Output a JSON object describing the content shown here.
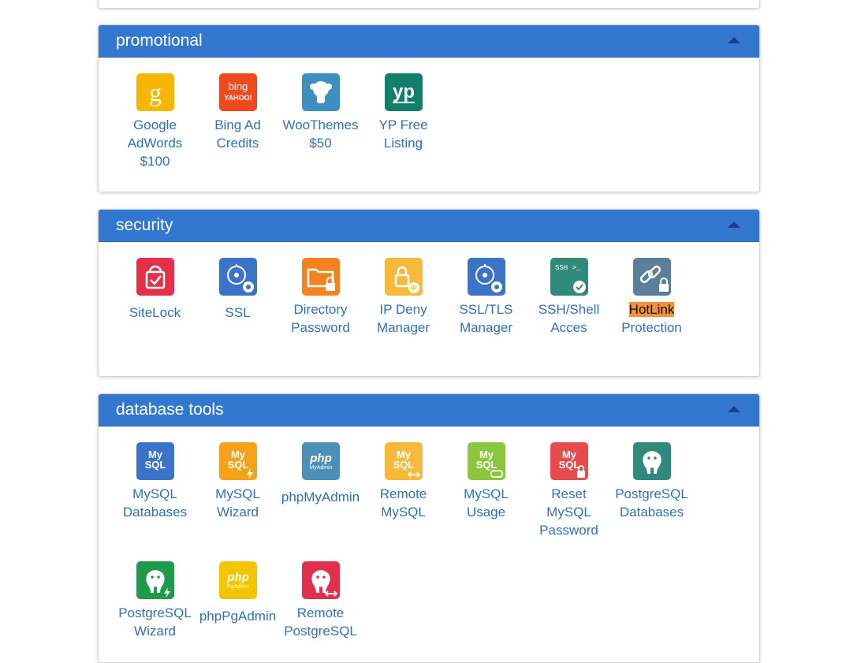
{
  "sections": [
    {
      "title": "promotional",
      "items": [
        {
          "label": "Google AdWords $100",
          "lines": [
            "Google",
            "AdWords",
            "$100"
          ],
          "icon": "google-adwords-icon",
          "color": "#f9b600"
        },
        {
          "label": "Bing Ad Credits",
          "lines": [
            "Bing Ad",
            "Credits"
          ],
          "icon": "bing-yahoo-icon",
          "color": "#ef4a1e",
          "glyph": [
            "bing",
            "YAHOO!"
          ]
        },
        {
          "label": "WooThemes $50",
          "lines": [
            "WooThemes",
            "$50"
          ],
          "icon": "woothemes-icon",
          "color": "#3d8fbf"
        },
        {
          "label": "YP Free Listing",
          "lines": [
            "YP Free",
            "Listing"
          ],
          "icon": "yp-icon",
          "color": "#10806a",
          "glyph": [
            "yp"
          ]
        }
      ]
    },
    {
      "title": "security",
      "items": [
        {
          "label": "SiteLock",
          "lines": [
            "SiteLock"
          ],
          "icon": "sitelock-icon",
          "color": "#e5304a"
        },
        {
          "label": "SSL",
          "lines": [
            "SSL"
          ],
          "icon": "ssl-icon",
          "color": "#3a73c8"
        },
        {
          "label": "Directory Password",
          "lines": [
            "Directory",
            "Password"
          ],
          "icon": "directory-password-icon",
          "color": "#f58220"
        },
        {
          "label": "IP Deny Manager",
          "lines": [
            "IP Deny",
            "Manager"
          ],
          "icon": "ip-deny-manager-icon",
          "color": "#f6b93a",
          "glyph": [
            "IP"
          ]
        },
        {
          "label": "SSL/TLS Manager",
          "lines": [
            "SSL/TLS",
            "Manager"
          ],
          "icon": "ssl-tls-manager-icon",
          "color": "#3a73c8"
        },
        {
          "label": "SSH/Shell Acces",
          "lines": [
            "SSH/Shell",
            "Acces"
          ],
          "icon": "ssh-shell-icon",
          "color": "#2f8a7c",
          "glyph": [
            "SSH >_"
          ]
        },
        {
          "label": "HotLink Protection",
          "lines": [
            "HotLink",
            "Protection"
          ],
          "icon": "hotlink-protection-icon",
          "color": "#5b7f9a",
          "highlightFirst": true
        }
      ]
    },
    {
      "title": "database tools",
      "items": [
        {
          "label": "MySQL Databases",
          "lines": [
            "MySQL",
            "Databases"
          ],
          "icon": "mysql-databases-icon",
          "color": "#3a73c8",
          "glyph": [
            "My",
            "SQL"
          ]
        },
        {
          "label": "MySQL Wizard",
          "lines": [
            "MySQL",
            "Wizard"
          ],
          "icon": "mysql-wizard-icon",
          "color": "#f5a21b",
          "glyph": [
            "My",
            "SQL"
          ]
        },
        {
          "label": "phpMyAdmin",
          "lines": [
            "phpMyAdmin"
          ],
          "icon": "phpmyadmin-icon",
          "color": "#4a90b8",
          "glyph": [
            "php",
            "MyAdmin"
          ]
        },
        {
          "label": "Remote MySQL",
          "lines": [
            "Remote",
            "MySQL"
          ],
          "icon": "remote-mysql-icon",
          "color": "#f6b93a",
          "glyph": [
            "My",
            "SQL"
          ]
        },
        {
          "label": "MySQL Usage",
          "lines": [
            "MySQL",
            "Usage"
          ],
          "icon": "mysql-usage-icon",
          "color": "#8cc63f",
          "glyph": [
            "My",
            "SQL"
          ]
        },
        {
          "label": "Reset MySQL Password",
          "lines": [
            "Reset",
            "MySQL",
            "Password"
          ],
          "icon": "reset-mysql-password-icon",
          "color": "#e84b4b",
          "glyph": [
            "My",
            "SQL"
          ]
        },
        {
          "label": "PostgreSQL Databases",
          "lines": [
            "PostgreSQL",
            "Databases"
          ],
          "icon": "postgresql-databases-icon",
          "color": "#2f8a7c"
        },
        {
          "label": "PostgreSQL Wizard",
          "lines": [
            "PostgreSQL",
            "Wizard"
          ],
          "icon": "postgresql-wizard-icon",
          "color": "#1f9a4a"
        },
        {
          "label": "phpPgAdmin",
          "lines": [
            "phpPgAdmin"
          ],
          "icon": "phppgadmin-icon",
          "color": "#f5c400",
          "glyph": [
            "php",
            "PgAdmin"
          ]
        },
        {
          "label": "Remote PostgreSQL",
          "lines": [
            "Remote",
            "PostgreSQL"
          ],
          "icon": "remote-postgresql-icon",
          "color": "#e0304e"
        }
      ]
    }
  ],
  "ui": {
    "collapse_icon": "caret-up-icon",
    "header_color": "#3278d1",
    "label_color": "#2f6fba",
    "highlight_color": "#f2913a"
  }
}
